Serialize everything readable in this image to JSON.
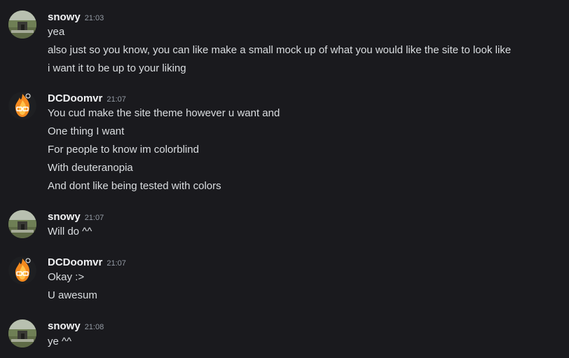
{
  "messages": [
    {
      "username": "snowy",
      "timestamp": "21:03",
      "avatar": "snowy-landscape-avatar",
      "lines": [
        "yea",
        "also just so you know, you can like make a small mock up of what you would like the site to look like",
        "i want it to be up to your liking"
      ]
    },
    {
      "username": "DCDoomvr",
      "timestamp": "21:07",
      "avatar": "flame-skull-avatar",
      "lines": [
        "You cud make the site theme however u want and",
        "One thing I want",
        "For people to know im colorblind",
        "With deuteranopia",
        "And dont like being tested with colors"
      ]
    },
    {
      "username": "snowy",
      "timestamp": "21:07",
      "avatar": "snowy-landscape-avatar",
      "lines": [
        "Will do ^^"
      ]
    },
    {
      "username": "DCDoomvr",
      "timestamp": "21:07",
      "avatar": "flame-skull-avatar",
      "lines": [
        "Okay :>",
        "U awesum"
      ]
    },
    {
      "username": "snowy",
      "timestamp": "21:08",
      "avatar": "snowy-landscape-avatar",
      "lines": [
        "ye ^^"
      ]
    }
  ],
  "colors": {
    "background": "#1a1a1e",
    "username": "#f2f3f5",
    "text": "#dbdee1",
    "timestamp": "#949ba4"
  }
}
